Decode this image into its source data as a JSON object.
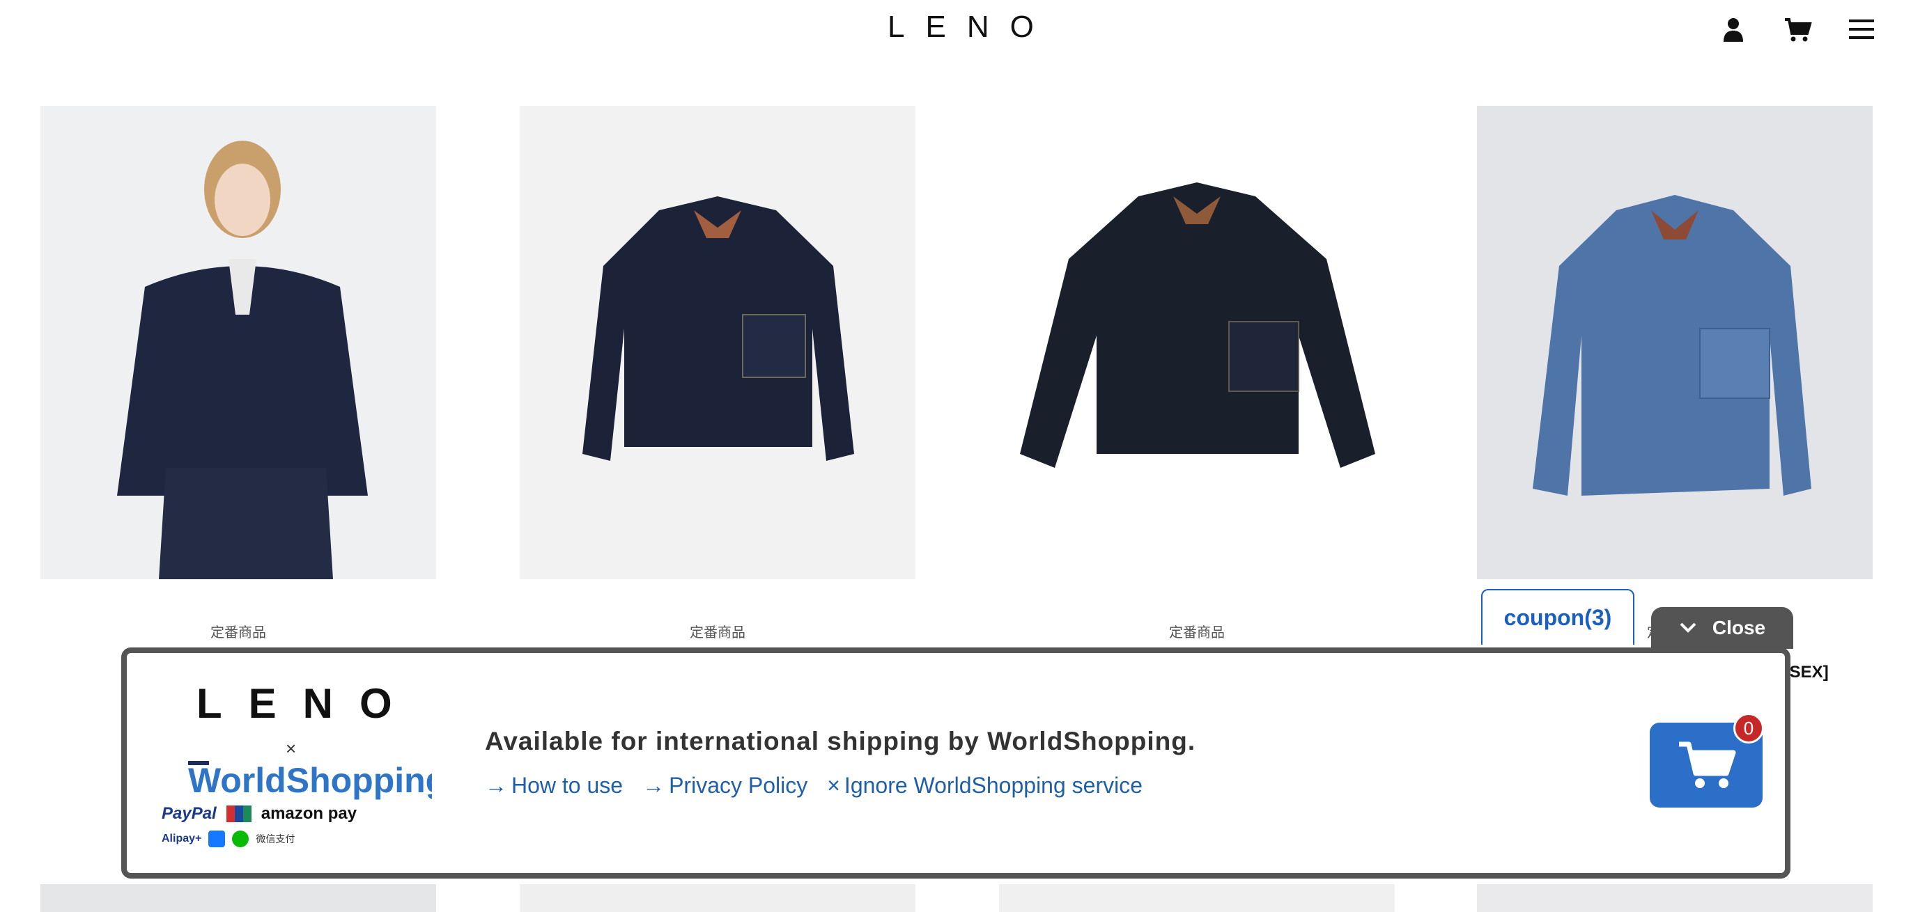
{
  "header": {
    "logo": "LENO",
    "icons": [
      "user-icon",
      "cart-icon",
      "menu-icon"
    ]
  },
  "products": [
    {
      "tag": "定番商品"
    },
    {
      "tag": "定番商品"
    },
    {
      "tag": "定番商品"
    },
    {
      "tag": "定番商品"
    }
  ],
  "coupon": {
    "label": "coupon(3)"
  },
  "close_tab": {
    "label": "Close"
  },
  "partial_title": "ISEX]",
  "banner": {
    "logo": "LENO",
    "cross": "×",
    "worldshopping": "WorldShopping",
    "payments": [
      "PayPal",
      "amazon pay",
      "Alipay+",
      "微信支付"
    ],
    "title": "Available for international shipping by WorldShopping.",
    "links": [
      {
        "arrow": "→",
        "label": "How to use"
      },
      {
        "arrow": "→",
        "label": "Privacy Policy"
      },
      {
        "arrow": "×",
        "label": "Ignore WorldShopping service"
      }
    ],
    "cart_count": "0"
  },
  "colors": {
    "accent": "#1b5fc1",
    "banner_border": "#555555",
    "cart_button": "#2c6fc9",
    "badge": "#c62828"
  }
}
